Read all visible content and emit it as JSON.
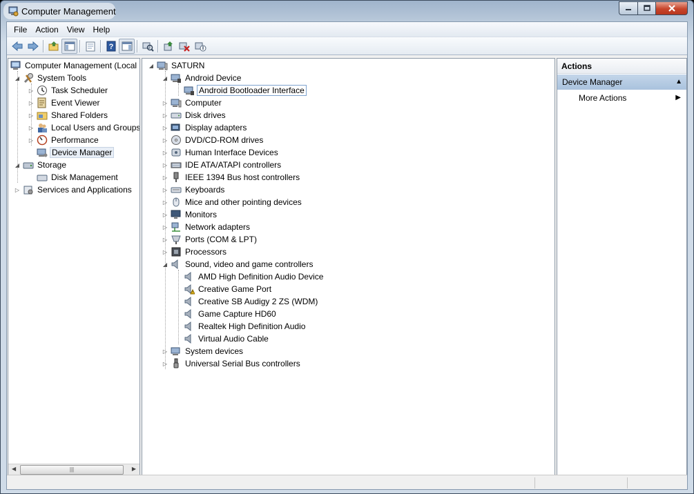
{
  "window": {
    "title": "Computer Management"
  },
  "menu": [
    "File",
    "Action",
    "View",
    "Help"
  ],
  "toolbar": {
    "buttons": [
      "back-icon",
      "forward-icon",
      "up-folder-icon",
      "show-hide-console-tree-icon",
      "properties-icon",
      "help-icon",
      "show-hide-action-pane-icon",
      "scan-hardware-icon",
      "update-driver-icon",
      "uninstall-icon",
      "disable-icon"
    ]
  },
  "left_tree": {
    "root": "Computer Management (Local",
    "items": [
      {
        "label": "System Tools",
        "icon": "tools-icon"
      },
      {
        "label": "Task Scheduler",
        "icon": "clock-icon"
      },
      {
        "label": "Event Viewer",
        "icon": "event-viewer-icon"
      },
      {
        "label": "Shared Folders",
        "icon": "shared-folder-icon"
      },
      {
        "label": "Local Users and Groups",
        "icon": "users-icon"
      },
      {
        "label": "Performance",
        "icon": "performance-icon"
      },
      {
        "label": "Device Manager",
        "icon": "device-manager-icon"
      },
      {
        "label": "Storage",
        "icon": "storage-icon"
      },
      {
        "label": "Disk Management",
        "icon": "disk-icon"
      },
      {
        "label": "Services and Applications",
        "icon": "services-icon"
      }
    ]
  },
  "device_tree": {
    "root": "SATURN",
    "categories": [
      {
        "label": "Android Device",
        "icon": "android-device-icon"
      },
      {
        "label": "Android Bootloader Interface",
        "icon": "android-interface-icon"
      },
      {
        "label": "Computer",
        "icon": "computer-icon"
      },
      {
        "label": "Disk drives",
        "icon": "disk-drive-icon"
      },
      {
        "label": "Display adapters",
        "icon": "display-adapter-icon"
      },
      {
        "label": "DVD/CD-ROM drives",
        "icon": "dvd-icon"
      },
      {
        "label": "Human Interface Devices",
        "icon": "hid-icon"
      },
      {
        "label": "IDE ATA/ATAPI controllers",
        "icon": "ide-icon"
      },
      {
        "label": "IEEE 1394 Bus host controllers",
        "icon": "firewire-icon"
      },
      {
        "label": "Keyboards",
        "icon": "keyboard-icon"
      },
      {
        "label": "Mice and other pointing devices",
        "icon": "mouse-icon"
      },
      {
        "label": "Monitors",
        "icon": "monitor-icon"
      },
      {
        "label": "Network adapters",
        "icon": "network-icon"
      },
      {
        "label": "Ports (COM & LPT)",
        "icon": "port-icon"
      },
      {
        "label": "Processors",
        "icon": "processor-icon"
      },
      {
        "label": "Sound, video and game controllers",
        "icon": "speaker-icon"
      },
      {
        "label": "AMD High Definition Audio Device",
        "icon": "speaker-icon"
      },
      {
        "label": "Creative Game Port",
        "icon": "warning-speaker-icon"
      },
      {
        "label": "Creative SB Audigy 2 ZS (WDM)",
        "icon": "speaker-icon"
      },
      {
        "label": "Game Capture HD60",
        "icon": "speaker-icon"
      },
      {
        "label": "Realtek High Definition Audio",
        "icon": "speaker-icon"
      },
      {
        "label": "Virtual Audio Cable",
        "icon": "speaker-icon"
      },
      {
        "label": "System devices",
        "icon": "system-device-icon"
      },
      {
        "label": "Universal Serial Bus controllers",
        "icon": "usb-icon"
      }
    ]
  },
  "actions": {
    "header": "Actions",
    "section": "Device Manager",
    "more": "More Actions"
  },
  "colors": {
    "selection": "#e8eef6",
    "actions_section": "#b8cde4",
    "close_button": "#c7452b"
  }
}
